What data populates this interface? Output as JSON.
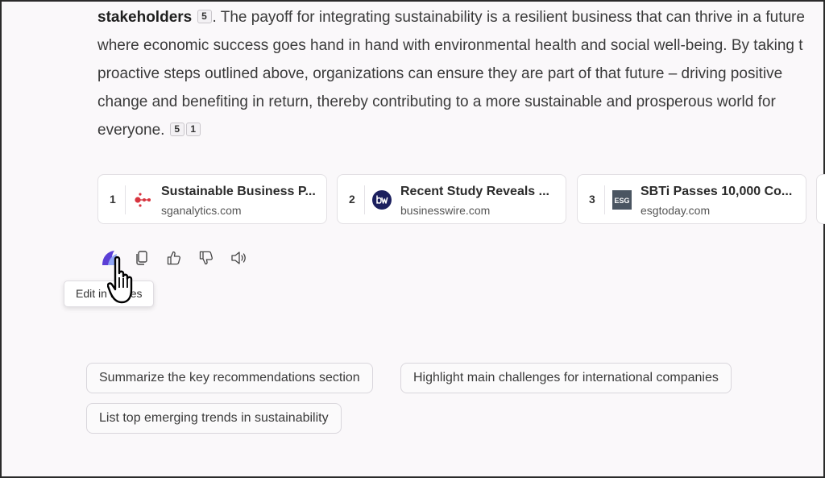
{
  "answer": {
    "line1_bold": "stakeholders",
    "line1_cite": "5",
    "line1_rest": ". The payoff for integrating sustainability is a resilient business that can thrive in a future",
    "line2": "where economic success goes hand in hand with environmental health and social well-being. By taking t",
    "line3": "proactive steps outlined above, organizations can ensure they are part of that future – driving positive",
    "line4": "change and benefiting in return, thereby contributing to a more sustainable and prosperous world for",
    "line5": "everyone.",
    "line5_cites": [
      "5",
      "1"
    ]
  },
  "sources": [
    {
      "num": "1",
      "title": "Sustainable Business P...",
      "domain": "sganalytics.com",
      "logo": "sganalytics-logo"
    },
    {
      "num": "2",
      "title": "Recent Study Reveals ...",
      "domain": "businesswire.com",
      "logo": "businesswire-logo"
    },
    {
      "num": "3",
      "title": "SBTi Passes 10,000 Co...",
      "domain": "esgtoday.com",
      "logo": "esg-logo",
      "logo_text": "ESG"
    }
  ],
  "actions": [
    "edit-in-pages-icon",
    "copy-icon",
    "thumbs-up-icon",
    "thumbs-down-icon",
    "read-aloud-icon"
  ],
  "tooltip": "Edit in Pages",
  "suggestions": [
    "Summarize the key recommendations section",
    "Highlight main challenges for international companies",
    "List top emerging trends in sustainability"
  ],
  "colors": {
    "background": "#faf8fa",
    "sganalytics_red": "#d7343f",
    "businesswire_navy": "#1b1f5e",
    "esg_gray": "#4a5561",
    "pages_purple": "#5b3fd6"
  }
}
